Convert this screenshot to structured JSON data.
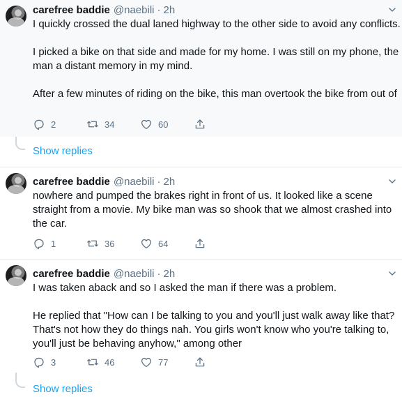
{
  "tweets": [
    {
      "name": "carefree baddie",
      "handle": "@naebili",
      "separator": "·",
      "time": "2h",
      "paragraphs": [
        "I quickly crossed the dual laned highway to the other side to avoid any conflicts.",
        "I picked a bike on that side and made for my home. I was still on my phone, the man a distant memory in my mind.",
        "After a few minutes of riding on the bike, this man overtook the bike from out of"
      ],
      "replies": "2",
      "retweets": "34",
      "likes": "60",
      "show_replies": "Show replies"
    },
    {
      "name": "carefree baddie",
      "handle": "@naebili",
      "separator": "·",
      "time": "2h",
      "paragraphs": [
        "nowhere and pumped the brakes right in front of us. It looked like a scene straight from a movie. My bike man was so shook that we almost crashed into the car."
      ],
      "replies": "1",
      "retweets": "36",
      "likes": "64"
    },
    {
      "name": "carefree baddie",
      "handle": "@naebili",
      "separator": "·",
      "time": "2h",
      "paragraphs": [
        "I was taken aback and so I asked the man if there was a problem.",
        "He replied that \"How can I be talking to you and you'll just walk away like that? That's not how they do things nah. You girls won't know who you're talking to, you'll just be behaving anyhow,\" among other"
      ],
      "replies": "3",
      "retweets": "46",
      "likes": "77",
      "show_replies": "Show replies"
    }
  ],
  "colors": {
    "accent": "#1da1f2",
    "secondary_text": "#5b7083",
    "highlight_bg": "#f7f9fa"
  },
  "icons": [
    "reply-icon",
    "retweet-icon",
    "like-icon",
    "share-icon",
    "caret-down-icon"
  ]
}
